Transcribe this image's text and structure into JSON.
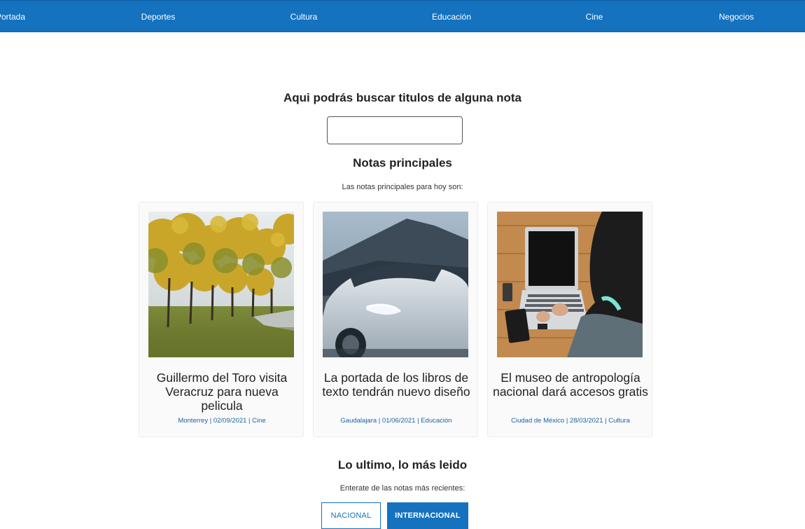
{
  "nav": {
    "items": [
      {
        "label": "Portada"
      },
      {
        "label": "Deportes"
      },
      {
        "label": "Cultura"
      },
      {
        "label": "Educación"
      },
      {
        "label": "Cine"
      },
      {
        "label": "Negocios"
      }
    ]
  },
  "search": {
    "title": "Aqui podrás buscar titulos de alguna nota",
    "value": ""
  },
  "main_notes": {
    "title": "Notas principales",
    "subtitle": "Las notas principales para hoy son:",
    "cards": [
      {
        "image_icon": "autumn-trees-photo",
        "title": "Guillermo del Toro visita Veracruz para nueva pelicula",
        "meta": "Monterrey | 02/09/2021 | Cine"
      },
      {
        "image_icon": "white-car-photo",
        "title": "La portada de los libros de texto tendrán nuevo diseño",
        "meta": "Gaudalajara | 01/06/2021 | Educación"
      },
      {
        "image_icon": "laptop-photo",
        "title": "El museo de antropología nacional dará accesos gratis",
        "meta": "Ciudad de México | 28/03/2021 | Cultura"
      }
    ]
  },
  "latest": {
    "title": "Lo ultimo, lo más leido",
    "subtitle": "Enterate de las notas más recientes:",
    "buttons": {
      "national": "NACIONAL",
      "international": "INTERNACIONAL"
    }
  },
  "colors": {
    "nav_bg": "#1472bf",
    "link": "#1b63a6"
  }
}
